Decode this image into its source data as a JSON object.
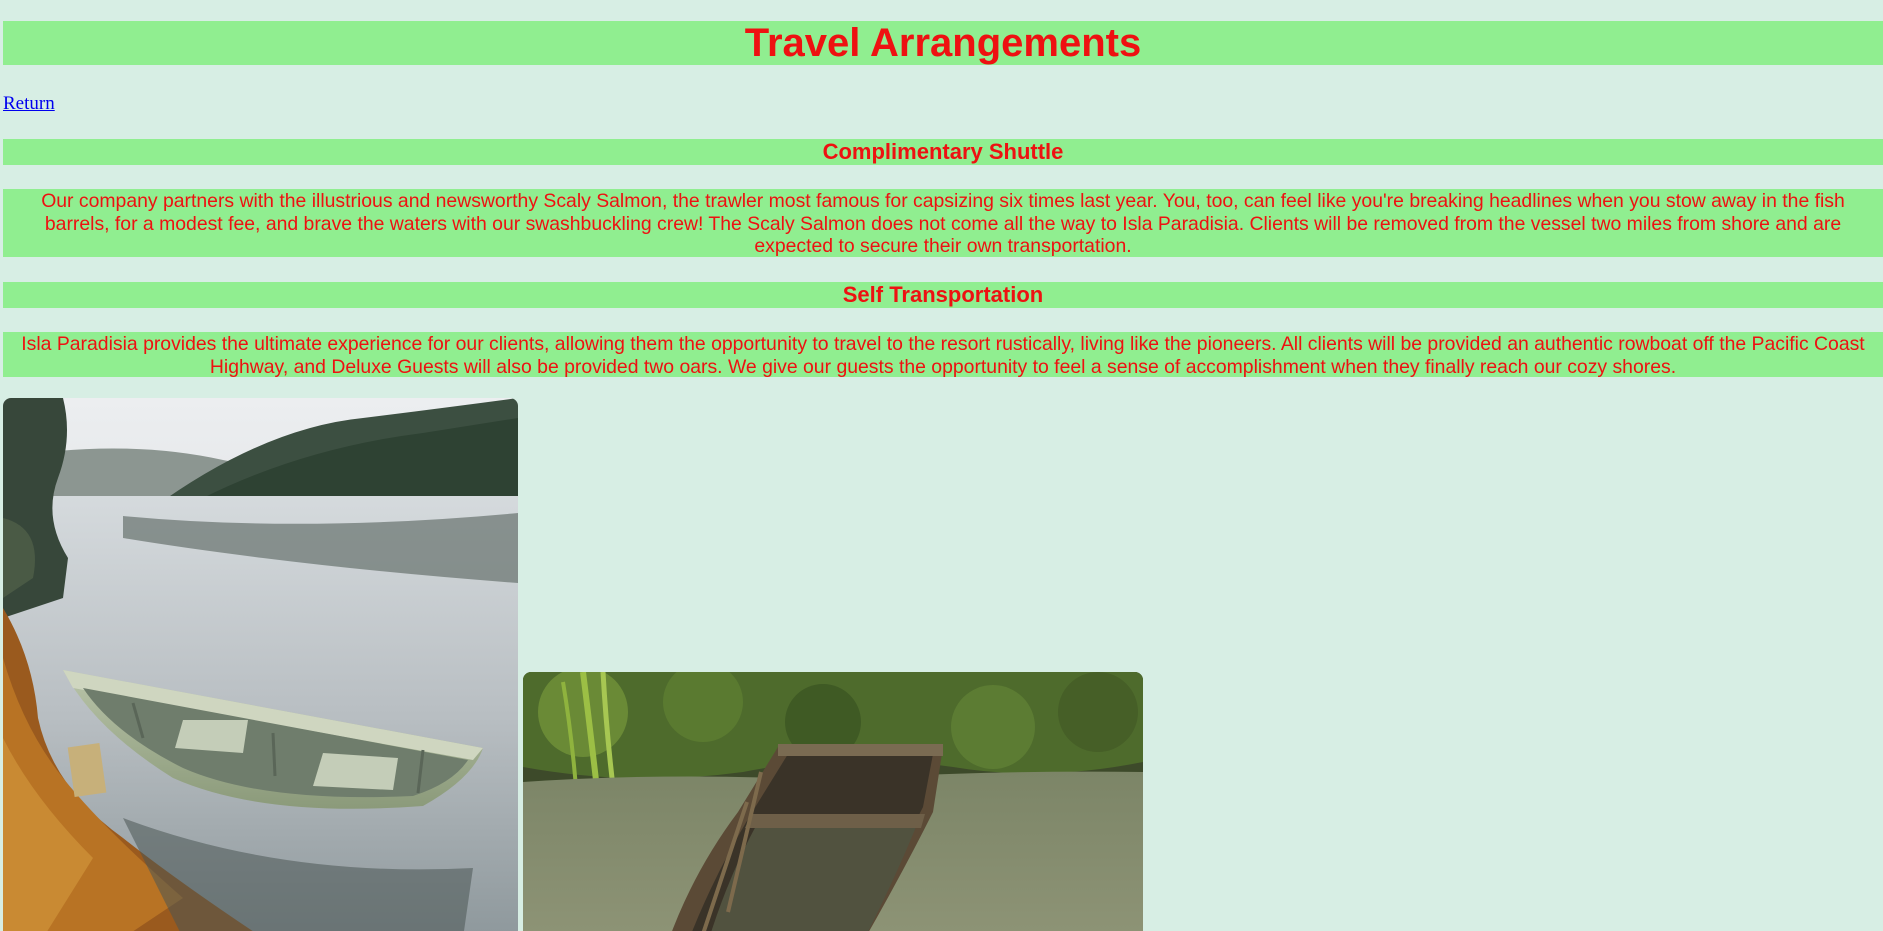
{
  "page": {
    "title": "Travel Arrangements",
    "return_link": "Return"
  },
  "sections": [
    {
      "heading": "Complimentary Shuttle",
      "body": "Our company partners with the illustrious and newsworthy Scaly Salmon, the trawler most famous for capsizing six times last year. You, too, can feel like you're breaking headlines when you stow away in the fish barrels, for a modest fee, and brave the waters with our swashbuckling crew! The Scaly Salmon does not come all the way to Isla Paradisia. Clients will be removed from the vessel two miles from shore and are expected to secure their own transportation."
    },
    {
      "heading": "Self Transportation",
      "body": "Isla Paradisia provides the ultimate experience for our clients, allowing them the opportunity to travel to the resort rustically, living like the pioneers. All clients will be provided an authentic rowboat off the Pacific Coast Highway, and Deluxe Guests will also be provided two oars. We give our guests the opportunity to feel a sense of accomplishment when they finally reach our cozy shores."
    }
  ],
  "images": [
    {
      "subject": "rowboat on misty lake shore with autumn leaves"
    },
    {
      "subject": "sunken wooden rowboat in murky pond"
    }
  ],
  "colors": {
    "background": "#d7eee4",
    "band": "#90ee90",
    "text": "#ee1111",
    "link": "#0000ee"
  }
}
